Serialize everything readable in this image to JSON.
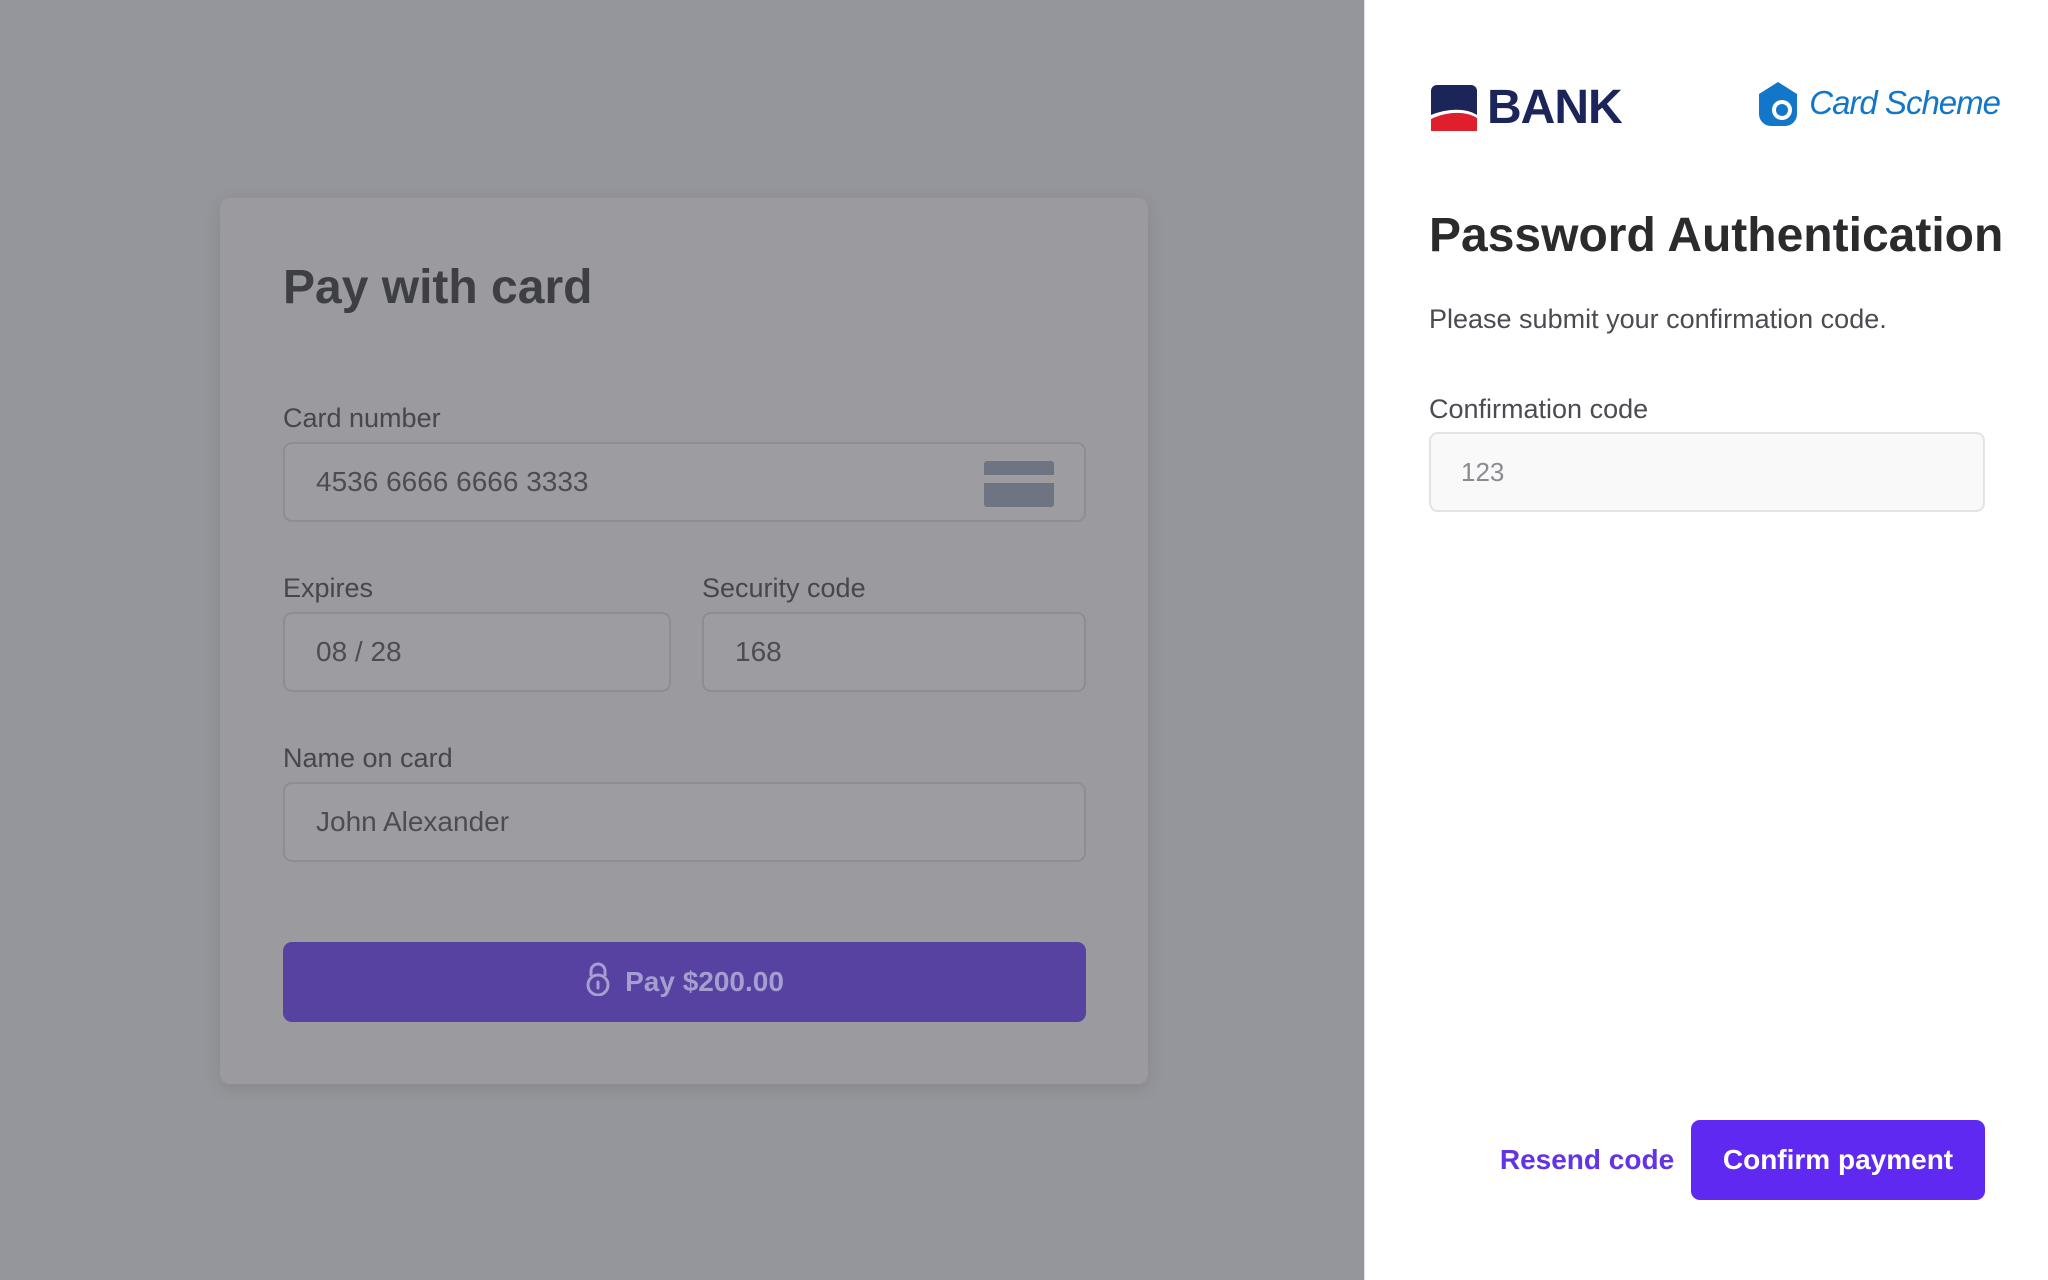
{
  "checkout": {
    "title": "Pay with card",
    "card_number": {
      "label": "Card number",
      "value": "4536 6666 6666 3333",
      "icon": "credit-card-icon"
    },
    "expires": {
      "label": "Expires",
      "value": "08 / 28"
    },
    "security_code": {
      "label": "Security code",
      "value": "168"
    },
    "name_on_card": {
      "label": "Name on card",
      "value": "John Alexander"
    },
    "pay_button": {
      "label": "Pay $200.00",
      "icon": "lock-icon"
    }
  },
  "auth": {
    "bank_logo_text": "BANK",
    "scheme_logo_text": "Card Scheme",
    "title": "Password Authentication",
    "subtitle": "Please submit your confirmation code.",
    "code_field": {
      "label": "Confirmation code",
      "placeholder": "123",
      "value": ""
    },
    "resend_label": "Resend code",
    "confirm_label": "Confirm payment"
  },
  "colors": {
    "accent": "#6029f2",
    "overlay": "#95969b",
    "bank_navy": "#1c2559",
    "bank_red": "#e01f2d",
    "scheme_blue": "#1277c9"
  }
}
